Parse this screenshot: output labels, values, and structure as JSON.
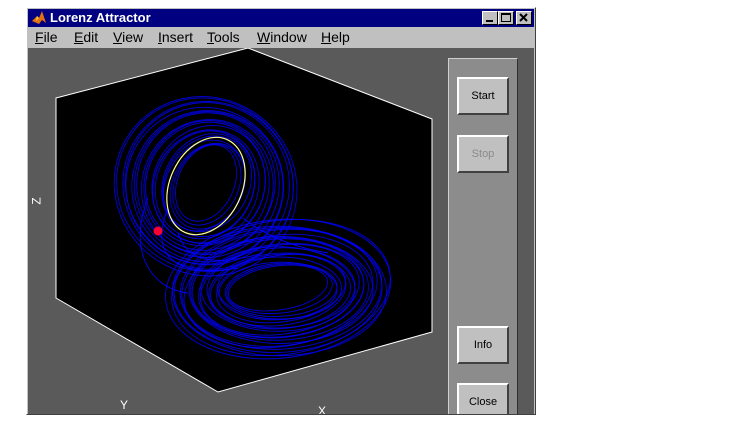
{
  "window": {
    "title": "Lorenz Attractor",
    "title_icon": "matlab-logo-icon"
  },
  "menu": [
    {
      "pre": "",
      "ul": "F",
      "post": "ile"
    },
    {
      "pre": "",
      "ul": "E",
      "post": "dit"
    },
    {
      "pre": "",
      "ul": "V",
      "post": "iew"
    },
    {
      "pre": "",
      "ul": "I",
      "post": "nsert"
    },
    {
      "pre": "",
      "ul": "T",
      "post": "ools"
    },
    {
      "pre": "",
      "ul": "W",
      "post": "indow"
    },
    {
      "pre": "",
      "ul": "H",
      "post": "elp"
    }
  ],
  "axes": {
    "x": "X",
    "y": "Y",
    "z": "Z"
  },
  "controls": {
    "start": "Start",
    "stop": "Stop",
    "info": "Info",
    "close": "Close"
  },
  "colors": {
    "titlebar": "#000080",
    "plot_background": "#000000",
    "trajectory": "#0000ff",
    "current_orbit": "#ffff99",
    "marker": "#ff0033"
  }
}
